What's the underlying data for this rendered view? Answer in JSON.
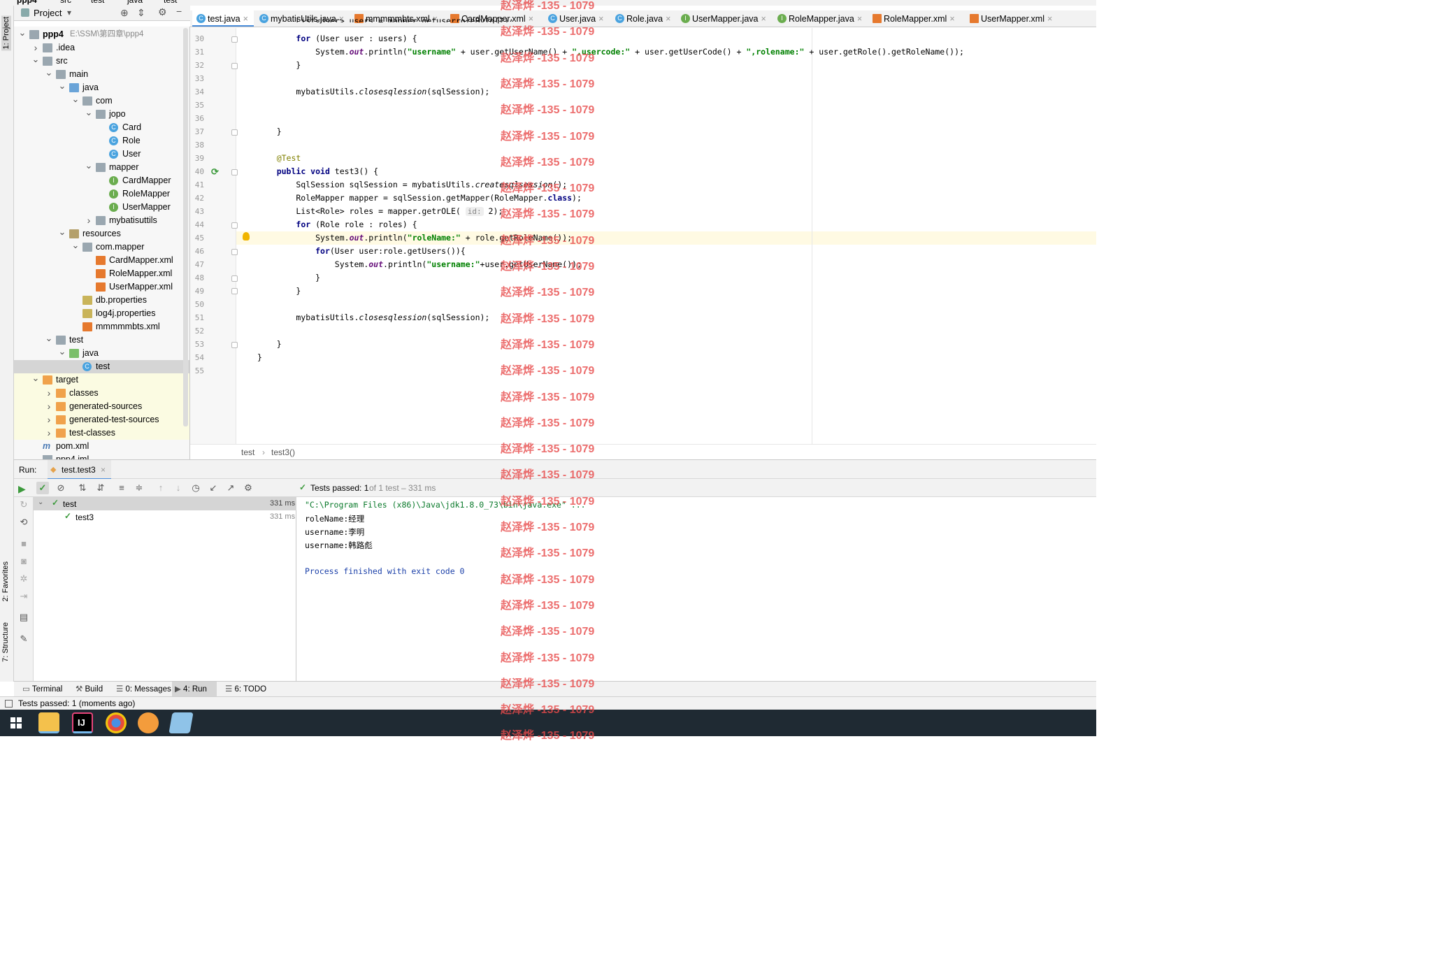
{
  "navbar": {
    "crumbs": [
      "ppp4",
      "src",
      "test",
      "java",
      "test"
    ]
  },
  "left_strip": {
    "project": "1: Project",
    "favorites": "2: Favorites",
    "structure": "7: Structure"
  },
  "project_panel": {
    "title": "Project",
    "tree": [
      {
        "label": "ppp4",
        "path": "E:\\SSM\\第四章\\ppp4",
        "level": 0,
        "arrow": "open",
        "icon": "module-folder",
        "bold": true
      },
      {
        "label": ".idea",
        "level": 1,
        "arrow": "closed",
        "icon": "folder"
      },
      {
        "label": "src",
        "level": 1,
        "arrow": "open",
        "icon": "folder"
      },
      {
        "label": "main",
        "level": 2,
        "arrow": "open",
        "icon": "folder"
      },
      {
        "label": "java",
        "level": 3,
        "arrow": "open",
        "icon": "src-folder"
      },
      {
        "label": "com",
        "level": 4,
        "arrow": "open",
        "icon": "package"
      },
      {
        "label": "jopo",
        "level": 5,
        "arrow": "open",
        "icon": "package"
      },
      {
        "label": "Card",
        "level": 6,
        "icon": "class"
      },
      {
        "label": "Role",
        "level": 6,
        "icon": "class"
      },
      {
        "label": "User",
        "level": 6,
        "icon": "class"
      },
      {
        "label": "mapper",
        "level": 5,
        "arrow": "open",
        "icon": "package"
      },
      {
        "label": "CardMapper",
        "level": 6,
        "icon": "interface"
      },
      {
        "label": "RoleMapper",
        "level": 6,
        "icon": "interface"
      },
      {
        "label": "UserMapper",
        "level": 6,
        "icon": "interface"
      },
      {
        "label": "mybatisuttils",
        "level": 5,
        "arrow": "closed",
        "icon": "package"
      },
      {
        "label": "resources",
        "level": 3,
        "arrow": "open",
        "icon": "res-folder"
      },
      {
        "label": "com.mapper",
        "level": 4,
        "arrow": "open",
        "icon": "package"
      },
      {
        "label": "CardMapper.xml",
        "level": 5,
        "icon": "xml"
      },
      {
        "label": "RoleMapper.xml",
        "level": 5,
        "icon": "xml"
      },
      {
        "label": "UserMapper.xml",
        "level": 5,
        "icon": "xml"
      },
      {
        "label": "db.properties",
        "level": 4,
        "icon": "properties"
      },
      {
        "label": "log4j.properties",
        "level": 4,
        "icon": "properties"
      },
      {
        "label": "mmmmmbts.xml",
        "level": 4,
        "icon": "xml"
      },
      {
        "label": "test",
        "level": 2,
        "arrow": "open",
        "icon": "folder"
      },
      {
        "label": "java",
        "level": 3,
        "arrow": "open",
        "icon": "test-folder"
      },
      {
        "label": "test",
        "level": 4,
        "icon": "class",
        "selected": true
      },
      {
        "label": "target",
        "level": 1,
        "arrow": "open",
        "icon": "orange-folder",
        "excluded": true
      },
      {
        "label": "classes",
        "level": 2,
        "arrow": "closed",
        "icon": "orange-folder",
        "excluded": true
      },
      {
        "label": "generated-sources",
        "level": 2,
        "arrow": "closed",
        "icon": "orange-folder",
        "excluded": true
      },
      {
        "label": "generated-test-sources",
        "level": 2,
        "arrow": "closed",
        "icon": "orange-folder",
        "excluded": true
      },
      {
        "label": "test-classes",
        "level": 2,
        "arrow": "closed",
        "icon": "orange-folder",
        "excluded": true
      },
      {
        "label": "pom.xml",
        "level": 1,
        "icon": "maven"
      },
      {
        "label": "ppp4.iml",
        "level": 1,
        "icon": "iml"
      }
    ]
  },
  "tabs": [
    {
      "label": "test.java",
      "icon": "class",
      "active": true
    },
    {
      "label": "mybatisUtils.java",
      "icon": "class"
    },
    {
      "label": "mmmmmbts.xml",
      "icon": "xml"
    },
    {
      "label": "CardMapper.xml",
      "icon": "xml"
    },
    {
      "label": "User.java",
      "icon": "class"
    },
    {
      "label": "Role.java",
      "icon": "class"
    },
    {
      "label": "UserMapper.java",
      "icon": "interface"
    },
    {
      "label": "RoleMapper.java",
      "icon": "interface"
    },
    {
      "label": "RoleMapper.xml",
      "icon": "xml"
    },
    {
      "label": "UserMapper.xml",
      "icon": "xml"
    }
  ],
  "editor": {
    "lines": [
      {
        "n": 30,
        "html": "        <span class=\"kw\">for</span> (User user : users) {"
      },
      {
        "n": 31,
        "html": "            System.<span class=\"fld\">out</span>.println(<span class=\"str\">\"username\"</span> + user.getUserName() + <span class=\"str\">\",usercode:\"</span> + user.getUserCode() + <span class=\"str\">\",rolename:\"</span> + user.getRole().getRoleName());"
      },
      {
        "n": 32,
        "html": "        }"
      },
      {
        "n": 33,
        "html": ""
      },
      {
        "n": 34,
        "html": "        mybatisUtils.<span class=\"ital\">closesqlession</span>(sqlSession);"
      },
      {
        "n": 35,
        "html": ""
      },
      {
        "n": 36,
        "html": ""
      },
      {
        "n": 37,
        "html": "    }"
      },
      {
        "n": 38,
        "html": ""
      },
      {
        "n": 39,
        "html": "    <span class=\"ann\">@Test</span>"
      },
      {
        "n": 40,
        "html": "    <span class=\"kw\">public void</span> test3() {"
      },
      {
        "n": 41,
        "html": "        SqlSession sqlSession = mybatisUtils.<span class=\"ital\">createsqlsession</span>();"
      },
      {
        "n": 42,
        "html": "        RoleMapper mapper = sqlSession.getMapper(RoleMapper.<span class=\"kw\">class</span>);"
      },
      {
        "n": 43,
        "html": "        List&lt;Role&gt; roles = mapper.getrOLE( <span class=\"hint\">id:</span> 2);"
      },
      {
        "n": 44,
        "html": "        <span class=\"kw\">for</span> (Role role : roles) {"
      },
      {
        "n": 45,
        "html": "            System.<span class=\"fld\">out</span>.println(<span class=\"str\">\"roleName:\"</span> + role.getRoleName());"
      },
      {
        "n": 46,
        "html": "            <span class=\"kw\">for</span>(User user:role.getUsers()){"
      },
      {
        "n": 47,
        "html": "                System.<span class=\"fld\">out</span>.println(<span class=\"str\">\"username:\"</span>+user.getUserName());"
      },
      {
        "n": 48,
        "html": "            }"
      },
      {
        "n": 49,
        "html": "        }"
      },
      {
        "n": 50,
        "html": ""
      },
      {
        "n": 51,
        "html": "        mybatisUtils.<span class=\"ital\">closesqlession</span>(sqlSession);"
      },
      {
        "n": 52,
        "html": ""
      },
      {
        "n": 53,
        "html": "    }"
      },
      {
        "n": 54,
        "html": "}"
      },
      {
        "n": 55,
        "html": ""
      }
    ],
    "top_partial": "        List<User> users = mapper.getuserroleById(2);"
  },
  "breadcrumb": {
    "cls": "test",
    "method": "test3()"
  },
  "run": {
    "label": "Run:",
    "config": "test.test3",
    "status_bold": "Tests passed: 1",
    "status_rest": " of 1 test – 331 ms",
    "tree": [
      {
        "name": "test",
        "time": "331 ms",
        "selected": true
      },
      {
        "name": "test3",
        "time": "331 ms"
      }
    ],
    "console": [
      {
        "text": "\"C:\\Program Files (x86)\\Java\\jdk1.8.0_73\\bin\\java.exe\" ...",
        "color": "#0a7a2b"
      },
      {
        "text": "roleName:经理",
        "color": "#000"
      },
      {
        "text": "username:李明",
        "color": "#000"
      },
      {
        "text": "username:韩路彪",
        "color": "#000"
      },
      {
        "text": "",
        "color": "#000"
      },
      {
        "text": "Process finished with exit code 0",
        "color": "#1a3fa8"
      }
    ]
  },
  "bottom_tabs": [
    {
      "label": "Terminal",
      "icon": "terminal-icon"
    },
    {
      "label": "Build",
      "icon": "hammer-icon"
    },
    {
      "label": "0: Messages",
      "icon": "messages-icon"
    },
    {
      "label": "4: Run",
      "icon": "run-icon",
      "active": true
    },
    {
      "label": "6: TODO",
      "icon": "todo-icon"
    }
  ],
  "status": {
    "text": "Tests passed: 1 (moments ago)"
  },
  "watermark": "赵泽烨 -135 - 1079",
  "taskbar": {
    "apps": [
      "windows-start",
      "file-explorer",
      "intellij-idea",
      "chrome",
      "browser-orange",
      "notepad"
    ]
  }
}
